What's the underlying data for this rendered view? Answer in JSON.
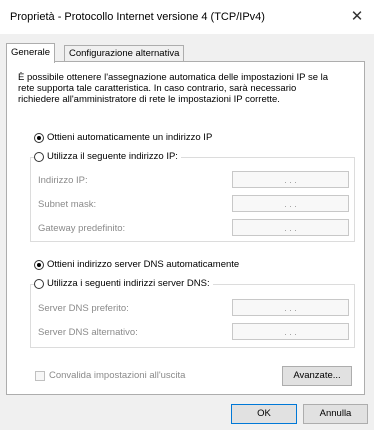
{
  "window": {
    "title": "Proprietà - Protocollo Internet versione 4 (TCP/IPv4)",
    "close_glyph": "✕"
  },
  "tabs": [
    {
      "label": "Generale",
      "active": true
    },
    {
      "label": "Configurazione alternativa",
      "active": false
    }
  ],
  "info_text": [
    "È possibile ottenere l'assegnazione automatica delle impostazioni IP se la",
    "rete supporta tale caratteristica. In caso contrario, sarà necessario",
    "richiedere all'amministratore di rete le impostazioni IP corrette."
  ],
  "ip": {
    "auto_label": "Ottieni automaticamente un indirizzo IP",
    "auto_selected": true,
    "manual_label": "Utilizza il seguente indirizzo IP:",
    "fields": [
      {
        "label": "Indirizzo IP:",
        "value": ". . ."
      },
      {
        "label": "Subnet mask:",
        "value": ". . ."
      },
      {
        "label": "Gateway predefinito:",
        "value": ". . ."
      }
    ]
  },
  "dns": {
    "auto_label": "Ottieni indirizzo server DNS automaticamente",
    "auto_selected": true,
    "manual_label": "Utilizza i seguenti indirizzi server DNS:",
    "fields": [
      {
        "label": "Server DNS preferito:",
        "value": ". . ."
      },
      {
        "label": "Server DNS alternativo:",
        "value": ". . ."
      }
    ]
  },
  "validate_label": "Convalida impostazioni all'uscita",
  "buttons": {
    "advanced": "Avanzate...",
    "ok": "OK",
    "cancel": "Annulla"
  }
}
